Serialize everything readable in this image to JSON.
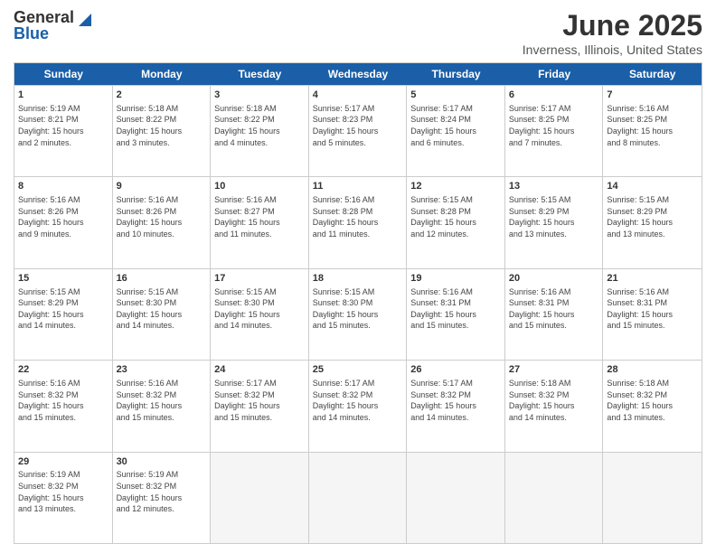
{
  "header": {
    "logo_line1": "General",
    "logo_line2": "Blue",
    "title": "June 2025",
    "subtitle": "Inverness, Illinois, United States"
  },
  "calendar": {
    "days_of_week": [
      "Sunday",
      "Monday",
      "Tuesday",
      "Wednesday",
      "Thursday",
      "Friday",
      "Saturday"
    ],
    "rows": [
      [
        {
          "day": "1",
          "info": "Sunrise: 5:19 AM\nSunset: 8:21 PM\nDaylight: 15 hours\nand 2 minutes."
        },
        {
          "day": "2",
          "info": "Sunrise: 5:18 AM\nSunset: 8:22 PM\nDaylight: 15 hours\nand 3 minutes."
        },
        {
          "day": "3",
          "info": "Sunrise: 5:18 AM\nSunset: 8:22 PM\nDaylight: 15 hours\nand 4 minutes."
        },
        {
          "day": "4",
          "info": "Sunrise: 5:17 AM\nSunset: 8:23 PM\nDaylight: 15 hours\nand 5 minutes."
        },
        {
          "day": "5",
          "info": "Sunrise: 5:17 AM\nSunset: 8:24 PM\nDaylight: 15 hours\nand 6 minutes."
        },
        {
          "day": "6",
          "info": "Sunrise: 5:17 AM\nSunset: 8:25 PM\nDaylight: 15 hours\nand 7 minutes."
        },
        {
          "day": "7",
          "info": "Sunrise: 5:16 AM\nSunset: 8:25 PM\nDaylight: 15 hours\nand 8 minutes."
        }
      ],
      [
        {
          "day": "8",
          "info": "Sunrise: 5:16 AM\nSunset: 8:26 PM\nDaylight: 15 hours\nand 9 minutes."
        },
        {
          "day": "9",
          "info": "Sunrise: 5:16 AM\nSunset: 8:26 PM\nDaylight: 15 hours\nand 10 minutes."
        },
        {
          "day": "10",
          "info": "Sunrise: 5:16 AM\nSunset: 8:27 PM\nDaylight: 15 hours\nand 11 minutes."
        },
        {
          "day": "11",
          "info": "Sunrise: 5:16 AM\nSunset: 8:28 PM\nDaylight: 15 hours\nand 11 minutes."
        },
        {
          "day": "12",
          "info": "Sunrise: 5:15 AM\nSunset: 8:28 PM\nDaylight: 15 hours\nand 12 minutes."
        },
        {
          "day": "13",
          "info": "Sunrise: 5:15 AM\nSunset: 8:29 PM\nDaylight: 15 hours\nand 13 minutes."
        },
        {
          "day": "14",
          "info": "Sunrise: 5:15 AM\nSunset: 8:29 PM\nDaylight: 15 hours\nand 13 minutes."
        }
      ],
      [
        {
          "day": "15",
          "info": "Sunrise: 5:15 AM\nSunset: 8:29 PM\nDaylight: 15 hours\nand 14 minutes."
        },
        {
          "day": "16",
          "info": "Sunrise: 5:15 AM\nSunset: 8:30 PM\nDaylight: 15 hours\nand 14 minutes."
        },
        {
          "day": "17",
          "info": "Sunrise: 5:15 AM\nSunset: 8:30 PM\nDaylight: 15 hours\nand 14 minutes."
        },
        {
          "day": "18",
          "info": "Sunrise: 5:15 AM\nSunset: 8:30 PM\nDaylight: 15 hours\nand 15 minutes."
        },
        {
          "day": "19",
          "info": "Sunrise: 5:16 AM\nSunset: 8:31 PM\nDaylight: 15 hours\nand 15 minutes."
        },
        {
          "day": "20",
          "info": "Sunrise: 5:16 AM\nSunset: 8:31 PM\nDaylight: 15 hours\nand 15 minutes."
        },
        {
          "day": "21",
          "info": "Sunrise: 5:16 AM\nSunset: 8:31 PM\nDaylight: 15 hours\nand 15 minutes."
        }
      ],
      [
        {
          "day": "22",
          "info": "Sunrise: 5:16 AM\nSunset: 8:32 PM\nDaylight: 15 hours\nand 15 minutes."
        },
        {
          "day": "23",
          "info": "Sunrise: 5:16 AM\nSunset: 8:32 PM\nDaylight: 15 hours\nand 15 minutes."
        },
        {
          "day": "24",
          "info": "Sunrise: 5:17 AM\nSunset: 8:32 PM\nDaylight: 15 hours\nand 15 minutes."
        },
        {
          "day": "25",
          "info": "Sunrise: 5:17 AM\nSunset: 8:32 PM\nDaylight: 15 hours\nand 14 minutes."
        },
        {
          "day": "26",
          "info": "Sunrise: 5:17 AM\nSunset: 8:32 PM\nDaylight: 15 hours\nand 14 minutes."
        },
        {
          "day": "27",
          "info": "Sunrise: 5:18 AM\nSunset: 8:32 PM\nDaylight: 15 hours\nand 14 minutes."
        },
        {
          "day": "28",
          "info": "Sunrise: 5:18 AM\nSunset: 8:32 PM\nDaylight: 15 hours\nand 13 minutes."
        }
      ],
      [
        {
          "day": "29",
          "info": "Sunrise: 5:19 AM\nSunset: 8:32 PM\nDaylight: 15 hours\nand 13 minutes."
        },
        {
          "day": "30",
          "info": "Sunrise: 5:19 AM\nSunset: 8:32 PM\nDaylight: 15 hours\nand 12 minutes."
        },
        {
          "day": "",
          "info": ""
        },
        {
          "day": "",
          "info": ""
        },
        {
          "day": "",
          "info": ""
        },
        {
          "day": "",
          "info": ""
        },
        {
          "day": "",
          "info": ""
        }
      ]
    ]
  }
}
